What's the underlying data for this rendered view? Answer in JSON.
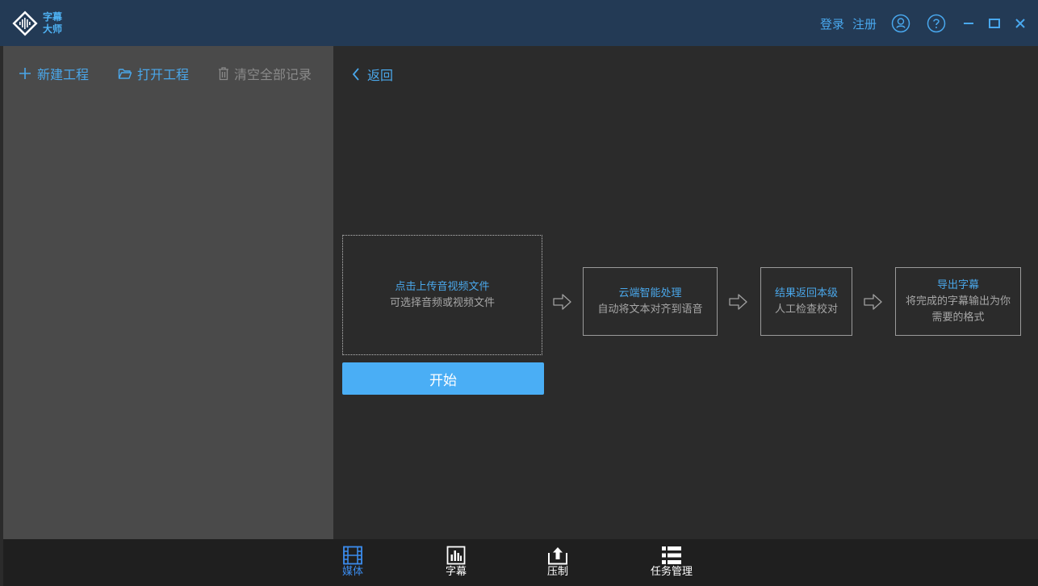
{
  "app": {
    "logo_line1": "字幕",
    "logo_line2": "大师"
  },
  "header": {
    "login": "登录",
    "register": "注册",
    "icons": [
      "user-icon",
      "help-icon",
      "minimize-icon",
      "maximize-icon",
      "close-icon"
    ]
  },
  "sidebar": {
    "new_project": "新建工程",
    "open_project": "打开工程",
    "clear_records": "清空全部记录"
  },
  "main": {
    "back": "返回",
    "upload": {
      "title": "点击上传音视频文件",
      "subtitle": "可选择音频或视频文件"
    },
    "start_button": "开始",
    "steps": [
      {
        "title": "云端智能处理",
        "desc": "自动将文本对齐到语音"
      },
      {
        "title": "结果返回本级",
        "desc": "人工检查校对"
      },
      {
        "title": "导出字幕",
        "desc": "将完成的字幕输出为你需要的格式"
      }
    ]
  },
  "bottom_nav": {
    "items": [
      {
        "label": "媒体",
        "icon": "film-icon",
        "active": true
      },
      {
        "label": "字幕",
        "icon": "bar-chart-icon",
        "active": false
      },
      {
        "label": "压制",
        "icon": "upload-icon",
        "active": false
      },
      {
        "label": "任务管理",
        "icon": "list-icon",
        "active": false
      }
    ]
  },
  "colors": {
    "accent": "#4aa7ea",
    "button": "#4aaef5",
    "titlebar": "#233a55",
    "sidebar": "#4a4a4a",
    "main": "#2b2b2b",
    "bottombar": "#1f1f1f",
    "active_nav": "#3b8df0"
  }
}
